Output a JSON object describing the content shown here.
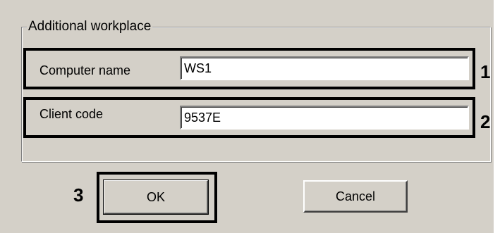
{
  "dialog": {
    "group_title": "Additional workplace",
    "computer_name": {
      "label": "Computer name",
      "value": "WS1"
    },
    "client_code": {
      "label": "Client code",
      "value": "9537E"
    },
    "buttons": {
      "ok_label": "OK",
      "cancel_label": "Cancel"
    }
  },
  "annotations": {
    "one": "1",
    "two": "2",
    "three": "3"
  }
}
